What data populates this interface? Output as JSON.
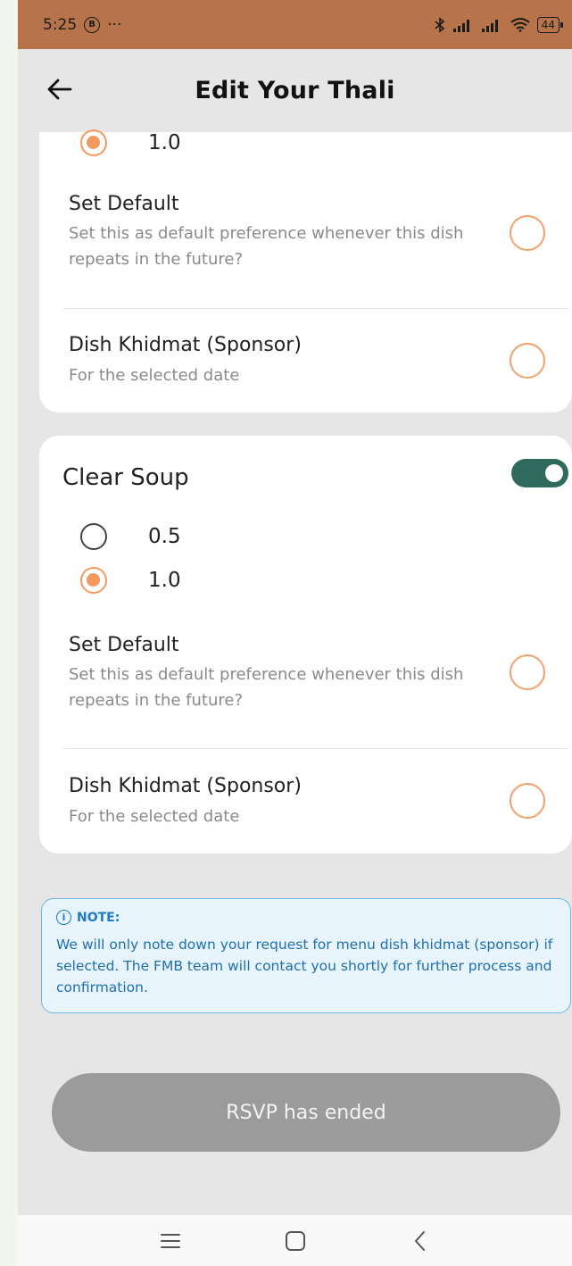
{
  "status": {
    "time": "5:25",
    "badge": "B",
    "dots": "···",
    "battery": "44"
  },
  "appbar": {
    "title": "Edit Your Thali"
  },
  "card1": {
    "partial_option_label": "1.0",
    "set_default": {
      "title": "Set Default",
      "subtitle": "Set this as default preference whenever this dish repeats in the future?"
    },
    "khidmat": {
      "title": "Dish Khidmat (Sponsor)",
      "subtitle": "For the selected date"
    }
  },
  "card2": {
    "dish_name": "Clear Soup",
    "toggle_on": true,
    "options": [
      {
        "label": "0.5",
        "selected": false
      },
      {
        "label": "1.0",
        "selected": true
      }
    ],
    "set_default": {
      "title": "Set Default",
      "subtitle": "Set this as default preference whenever this dish repeats in the future?"
    },
    "khidmat": {
      "title": "Dish Khidmat (Sponsor)",
      "subtitle": "For the selected date"
    }
  },
  "note": {
    "heading": "NOTE:",
    "icon": "info-icon",
    "text": "We will only note down your request for menu dish khidmat (sponsor) if selected. The FMB team will contact you shortly for further process and confirmation."
  },
  "rsvp_button": {
    "label": "RSVP has ended"
  },
  "colors": {
    "accent_orange": "#f59a5f",
    "toggle_green": "#2f6a5c",
    "status_bar": "#b7744a",
    "note_blue": "#1f7cc2"
  }
}
